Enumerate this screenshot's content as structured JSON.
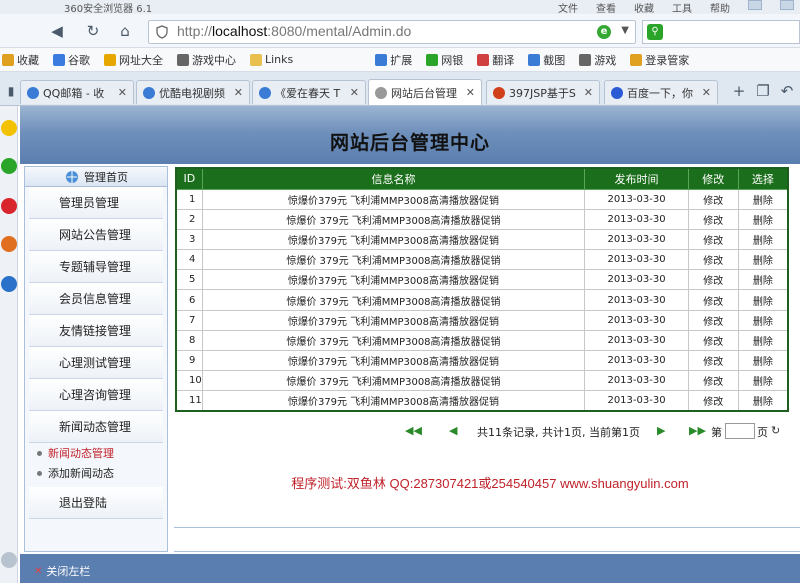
{
  "browser": {
    "title": "360安全浏览器 6.1",
    "menu": [
      "文件",
      "查看",
      "收藏",
      "工具",
      "帮助"
    ],
    "url_prefix": "http://",
    "url_host": "localhost",
    "url_rest": ":8080/mental/Admin.do",
    "bookmarks": [
      {
        "label": "收藏",
        "icon": "star-icon",
        "color": "#e0a020"
      },
      {
        "label": "谷歌",
        "icon": "google-icon",
        "color": "#3b7be0"
      },
      {
        "label": "网址大全",
        "icon": "web-nav-icon",
        "color": "#e6a800"
      },
      {
        "label": "游戏中心",
        "icon": "gamepad-icon",
        "color": "#666666"
      },
      {
        "label": "Links",
        "icon": "folder-icon",
        "color": "#e8c050"
      },
      {
        "label": "扩展",
        "icon": "grid-icon",
        "color": "#3a7bd5"
      },
      {
        "label": "网银",
        "icon": "bank-icon",
        "color": "#2aa52a"
      },
      {
        "label": "翻译",
        "icon": "translate-icon",
        "color": "#d04040"
      },
      {
        "label": "截图",
        "icon": "scissors-icon",
        "color": "#3a7bd5"
      },
      {
        "label": "游戏",
        "icon": "gamepad-icon",
        "color": "#666666"
      },
      {
        "label": "登录管家",
        "icon": "key-icon",
        "color": "#e0a020"
      }
    ],
    "tabs": [
      {
        "label": "QQ邮箱 - 收",
        "color": "#3a7bd5"
      },
      {
        "label": "优酷电视剧频",
        "color": "#3a7bd5"
      },
      {
        "label": "《爱在春天 T",
        "color": "#3a7bd5"
      },
      {
        "label": "网站后台管理",
        "color": "#999999"
      },
      {
        "label": "397JSP基于S",
        "color": "#d0401a"
      },
      {
        "label": "百度一下，你",
        "color": "#2a5bd5"
      }
    ]
  },
  "page": {
    "title": "网站后台管理中心",
    "nav_head": "管理首页",
    "nav_items": [
      "管理员管理",
      "网站公告管理",
      "专题辅导管理",
      "会员信息管理",
      "友情链接管理",
      "心理测试管理",
      "心理咨询管理",
      "新闻动态管理"
    ],
    "sub_items": [
      "新闻动态管理",
      "添加新闻动态"
    ],
    "logout": "退出登陆",
    "close_left": "关闭左栏",
    "colors": {
      "header": "#5a7eaf",
      "grid_head": "#1b6e1b",
      "sub_active": "#c0222a",
      "footer_text": "#c0222a"
    }
  },
  "table": {
    "headers": [
      "ID",
      "信息名称",
      "发布时间",
      "修改",
      "选择"
    ],
    "rows": [
      [
        "1",
        "惊爆价379元 飞利浦MMP3008高清播放器促销",
        "2013-03-30",
        "修改",
        "删除"
      ],
      [
        "2",
        "惊爆价 379元 飞利浦MMP3008高清播放器促销",
        "2013-03-30",
        "修改",
        "删除"
      ],
      [
        "3",
        "惊爆价379元 飞利浦MMP3008高清播放器促销",
        "2013-03-30",
        "修改",
        "删除"
      ],
      [
        "4",
        "惊爆价 379元 飞利浦MMP3008高清播放器促销",
        "2013-03-30",
        "修改",
        "删除"
      ],
      [
        "5",
        "惊爆价379元 飞利浦MMP3008高清播放器促销",
        "2013-03-30",
        "修改",
        "删除"
      ],
      [
        "6",
        "惊爆价 379元 飞利浦MMP3008高清播放器促销",
        "2013-03-30",
        "修改",
        "删除"
      ],
      [
        "7",
        "惊爆价379元 飞利浦MMP3008高清播放器促销",
        "2013-03-30",
        "修改",
        "删除"
      ],
      [
        "8",
        "惊爆价 379元 飞利浦MMP3008高清播放器促销",
        "2013-03-30",
        "修改",
        "删除"
      ],
      [
        "9",
        "惊爆价379元 飞利浦MMP3008高清播放器促销",
        "2013-03-30",
        "修改",
        "删除"
      ],
      [
        "10",
        "惊爆价 379元 飞利浦MMP3008高清播放器促销",
        "2013-03-30",
        "修改",
        "删除"
      ],
      [
        "11",
        "惊爆价379元 飞利浦MMP3008高清播放器促销",
        "2013-03-30",
        "修改",
        "删除"
      ]
    ]
  },
  "pager": {
    "summary": "共11条记录, 共计1页, 当前第1页",
    "goto_label": "第",
    "page_suffix": "页"
  },
  "footer": {
    "text": "程序测试:双鱼林 QQ:287307421或254540457 www.shuangyulin.com"
  }
}
